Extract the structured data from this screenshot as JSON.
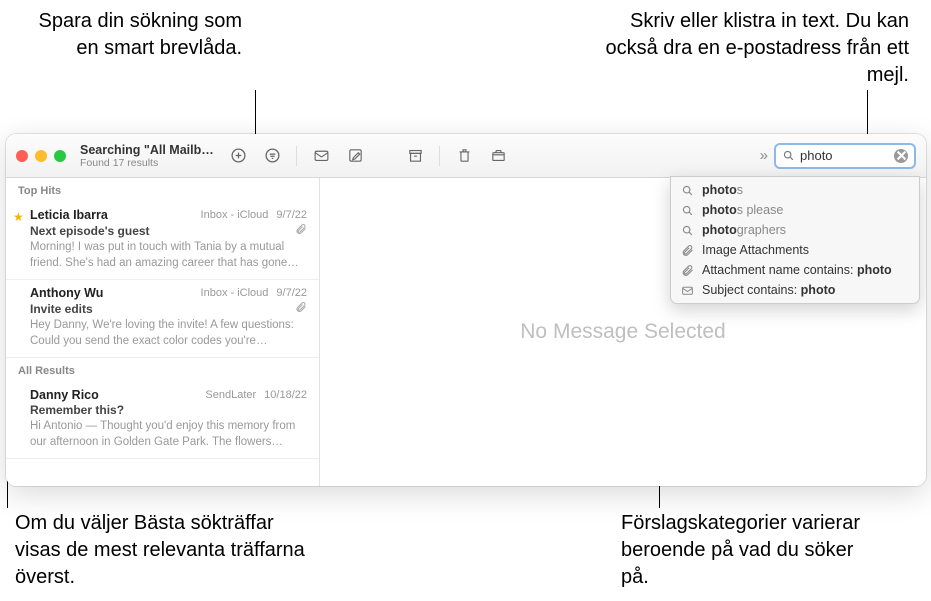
{
  "annotations": {
    "topleft": "Spara din sökning som en smart brevlåda.",
    "topright": "Skriv eller klistra in text. Du kan också dra en e-postadress från ett mejl.",
    "bottomleft": "Om du väljer Bästa sökträffar visas de mest relevanta träffarna överst.",
    "bottomright": "Förslagskategorier varierar beroende på vad du söker på."
  },
  "toolbar": {
    "title": "Searching \"All Mailbo...",
    "subtitle": "Found 17 results"
  },
  "search": {
    "value": "photo"
  },
  "sections": {
    "top_hits": "Top Hits",
    "all_results": "All Results"
  },
  "messages": [
    {
      "sender": "Leticia Ibarra",
      "mailbox": "Inbox - iCloud",
      "date": "9/7/22",
      "subject": "Next episode's guest",
      "preview": "Morning! I was put in touch with Tania by a mutual friend. She's had an amazing career that has gone do...",
      "starred": true,
      "attachment": true
    },
    {
      "sender": "Anthony Wu",
      "mailbox": "Inbox - iCloud",
      "date": "9/7/22",
      "subject": "Invite edits",
      "preview": "Hey Danny, We're loving the invite! A few questions: Could you send the exact color codes you're proposin...",
      "starred": false,
      "attachment": true
    }
  ],
  "all_results_messages": [
    {
      "sender": "Danny Rico",
      "mailbox": "SendLater",
      "date": "10/18/22",
      "subject": "Remember this?",
      "preview": "Hi Antonio — Thought you'd enjoy this memory from our afternoon in Golden Gate Park. The flowers were..."
    }
  ],
  "preview_placeholder": "No Message Selected",
  "suggestions": [
    {
      "icon": "search",
      "bold": "photo",
      "rest": "s"
    },
    {
      "icon": "search",
      "bold": "photo",
      "rest": "s please"
    },
    {
      "icon": "search",
      "bold": "photo",
      "rest": "graphers"
    },
    {
      "icon": "attach",
      "text": "Image Attachments"
    },
    {
      "icon": "attach",
      "text_prefix": "Attachment name contains: ",
      "bold": "photo"
    },
    {
      "icon": "mail",
      "text_prefix": "Subject contains: ",
      "bold": "photo"
    }
  ]
}
